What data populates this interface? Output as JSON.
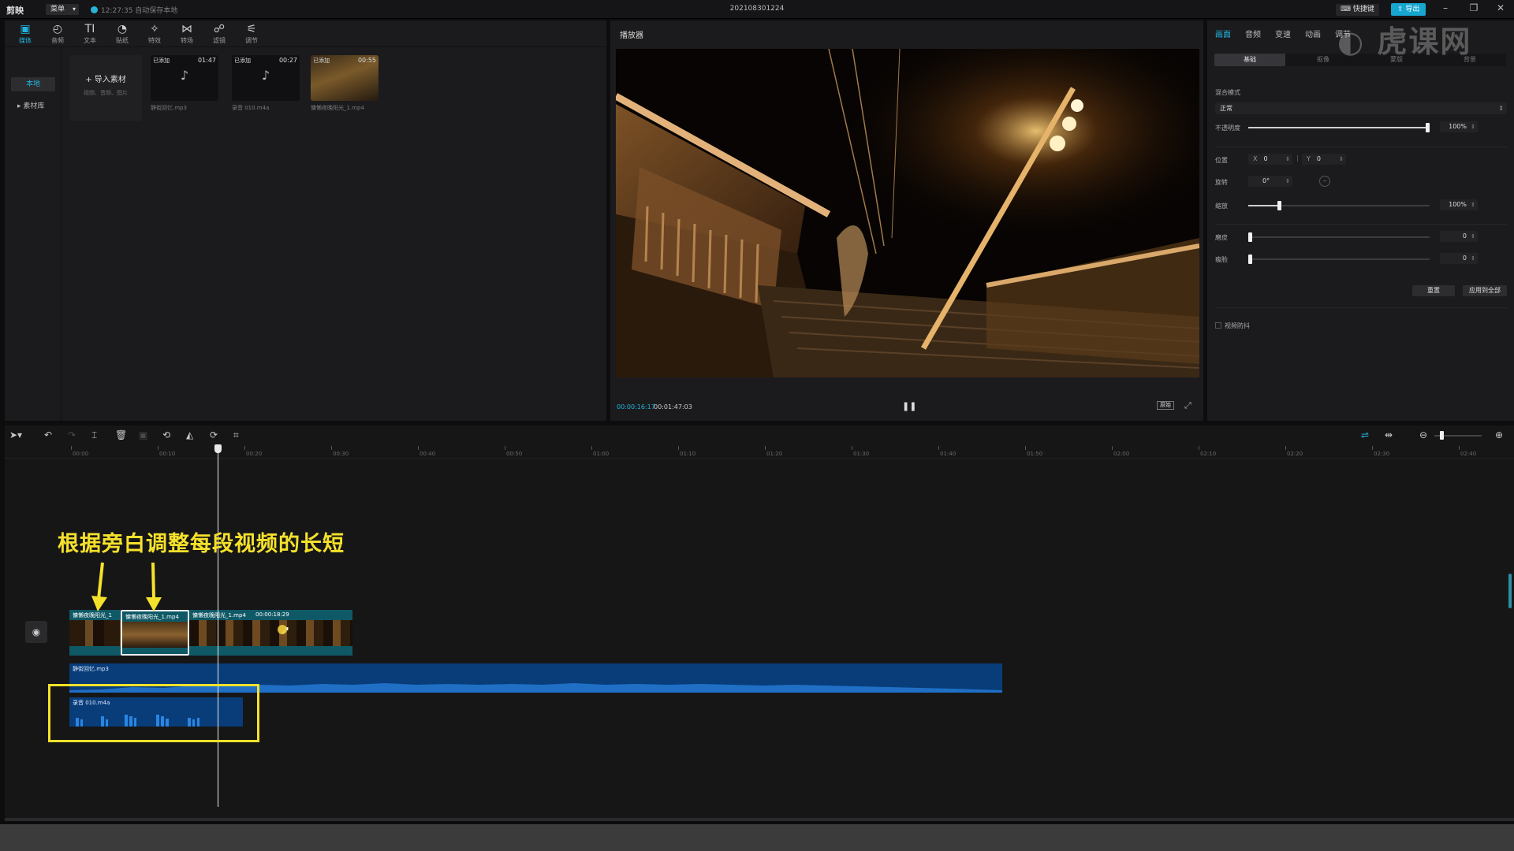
{
  "titlebar": {
    "app_name": "剪映",
    "menu_label": "菜单",
    "autosave": "12:27:35 自动保存本地",
    "doc_title": "202108301224",
    "shortcut_label": "快捷键",
    "export_label": "导出"
  },
  "toolbar": {
    "items": [
      {
        "label": "媒体",
        "icon": "▣"
      },
      {
        "label": "音频",
        "icon": "◴"
      },
      {
        "label": "文本",
        "icon": "TI"
      },
      {
        "label": "贴纸",
        "icon": "◔"
      },
      {
        "label": "特效",
        "icon": "✧"
      },
      {
        "label": "转场",
        "icon": "⋈"
      },
      {
        "label": "滤镜",
        "icon": "☍"
      },
      {
        "label": "调节",
        "icon": "⚟"
      }
    ]
  },
  "sidebar": {
    "items": [
      {
        "label": "本地"
      },
      {
        "label": "▸ 素材库"
      }
    ]
  },
  "media": {
    "import_label": "+ 导入素材",
    "import_sub": "视频、音频、图片",
    "cards": [
      {
        "tag": "已添加",
        "duration": "01:47",
        "name": "静街回忆.mp3",
        "icon": "music-note-icon"
      },
      {
        "tag": "已添加",
        "duration": "00:27",
        "name": "录音 010.m4a",
        "icon": "music-note-icon"
      },
      {
        "tag": "已添加",
        "duration": "00:55",
        "name": "慵懒夜晚阳光_1.mp4",
        "icon": "video-thumbnail"
      }
    ]
  },
  "player": {
    "title": "播放器",
    "current_time": "00:00:16:17",
    "total_time": "00:01:47:03",
    "ratio_label": "原始"
  },
  "properties": {
    "tabs": [
      "画面",
      "音频",
      "变速",
      "动画",
      "调节"
    ],
    "subtabs": [
      "基础",
      "抠像",
      "蒙版",
      "背景"
    ],
    "blend_mode_label": "混合模式",
    "blend_mode_value": "正常",
    "opacity_label": "不透明度",
    "opacity_value": "100%",
    "position_label": "位置",
    "pos_x_label": "X",
    "pos_x_value": "0",
    "pos_y_label": "Y",
    "pos_y_value": "0",
    "rotate_label": "旋转",
    "rotate_value": "0°",
    "scale_label": "缩放",
    "scale_value": "100%",
    "scale_level": 0.17,
    "sharpen_label": "磨皮",
    "sharpen_value": "0",
    "thin_label": "瘦脸",
    "thin_value": "0",
    "reset_label": "重置",
    "apply_all_label": "应用到全部",
    "stabilize_label": "视频防抖"
  },
  "timeline": {
    "ruler": [
      "00:00",
      "00:10",
      "00:20",
      "00:30",
      "00:40",
      "00:50",
      "01:00",
      "01:10",
      "01:20",
      "01:30",
      "01:40",
      "01:50",
      "02:00",
      "02:10",
      "02:20",
      "02:30",
      "02:40"
    ],
    "video_clips": [
      {
        "label": "慵懒夜晚阳光_1"
      },
      {
        "label": "慵懒夜晚阳光_1.mp4"
      },
      {
        "label": "慵懒夜晚阳光_1.mp4",
        "duration": "00:00:18:29"
      }
    ],
    "audio_music": "静街回忆.mp3",
    "audio_voice": "录音 010.m4a"
  },
  "annotation": {
    "text": "根据旁白调整每段视频的长短"
  },
  "watermark": "虎课网",
  "colors": {
    "accent": "#22b4de",
    "annotation": "#f5e12b",
    "video_clip": "#0f5966",
    "audio_clip": "#083d7a"
  }
}
